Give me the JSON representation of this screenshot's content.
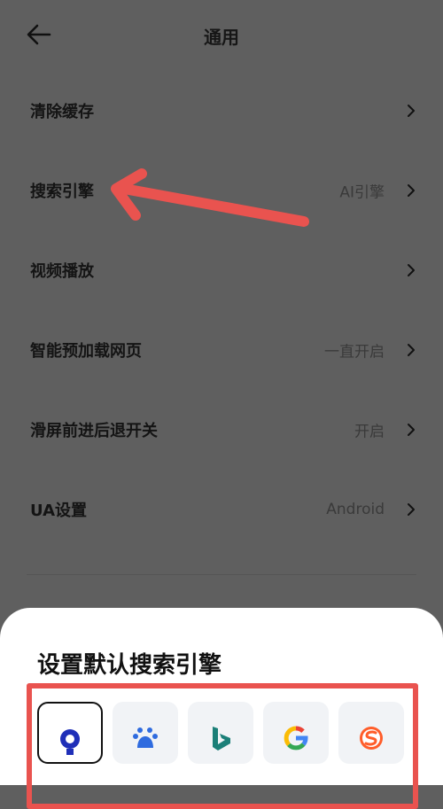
{
  "header": {
    "title": "通用"
  },
  "settings": {
    "items": [
      {
        "label": "清除缓存",
        "value": ""
      },
      {
        "label": "搜索引擎",
        "value": "AI引擎"
      },
      {
        "label": "视频播放",
        "value": ""
      },
      {
        "label": "智能预加载网页",
        "value": "一直开启"
      },
      {
        "label": "滑屏前进后退开关",
        "value": "开启"
      },
      {
        "label": "UA设置",
        "value": "Android"
      }
    ]
  },
  "sheet": {
    "title": "设置默认搜索引擎",
    "engines": [
      {
        "icon": "ai-search-icon",
        "selected": true
      },
      {
        "icon": "baidu-icon",
        "selected": false
      },
      {
        "icon": "bing-icon",
        "selected": false
      },
      {
        "icon": "google-icon",
        "selected": false
      },
      {
        "icon": "sogou-icon",
        "selected": false
      }
    ]
  },
  "colors": {
    "overlay": "#5f5f5f",
    "annotation": "#e9534f",
    "sheet": "#ffffff",
    "tile": "#f1f3f6"
  }
}
